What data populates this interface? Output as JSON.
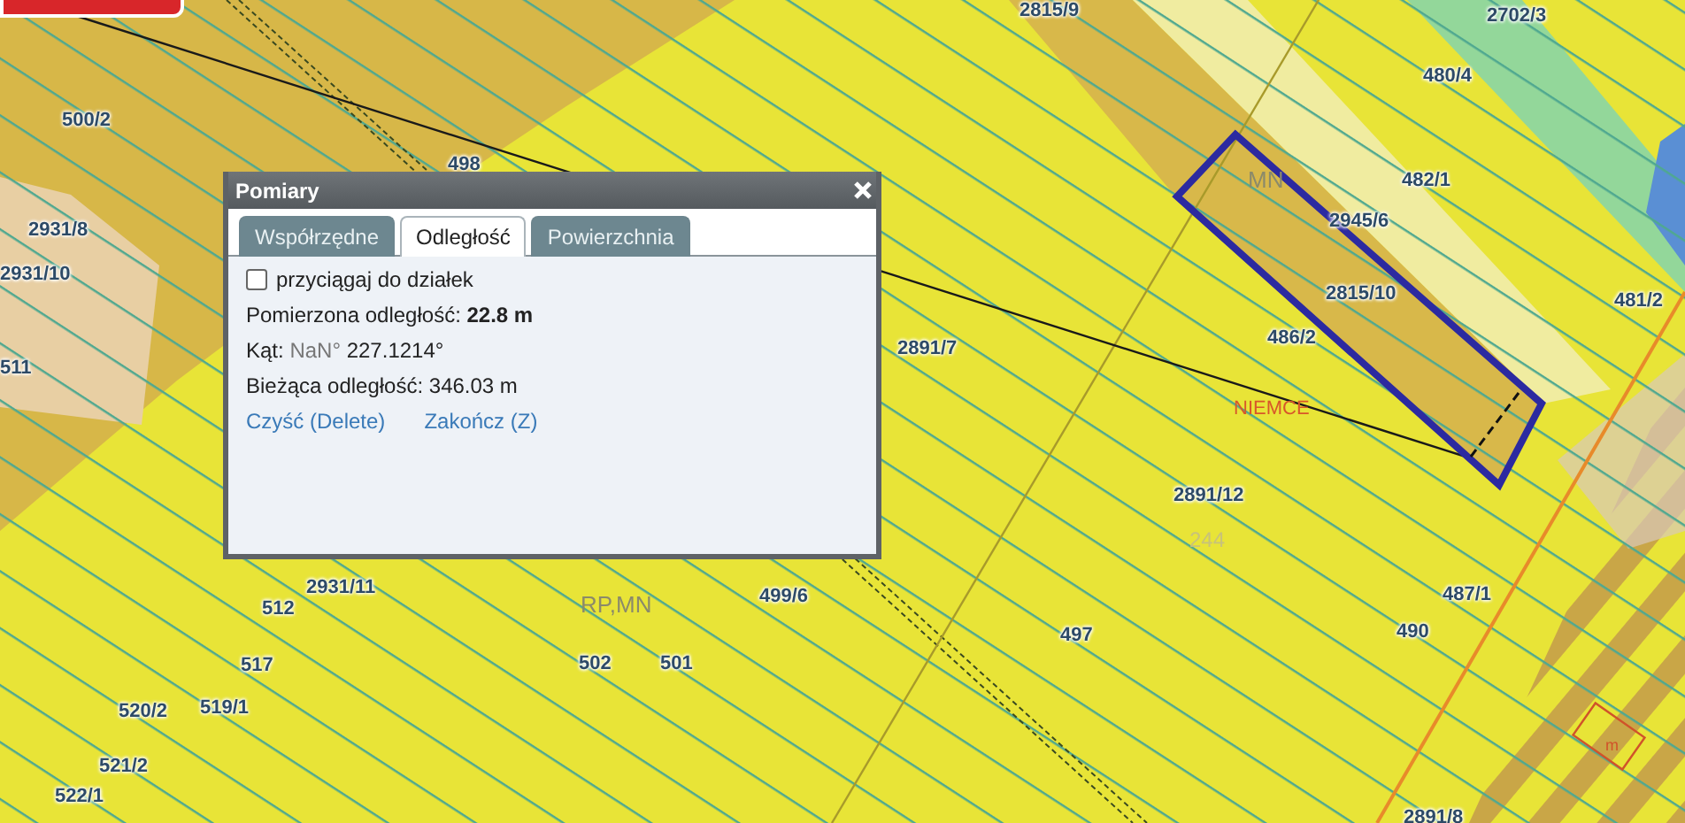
{
  "map": {
    "labels": [
      {
        "text": "500/2",
        "kind": "parcel"
      },
      {
        "text": "498",
        "kind": "parcel"
      },
      {
        "text": "2931/8",
        "kind": "parcel"
      },
      {
        "text": "2931/10",
        "kind": "parcel"
      },
      {
        "text": "511",
        "kind": "parcel"
      },
      {
        "text": "2815/9",
        "kind": "parcel"
      },
      {
        "text": "2702/3",
        "kind": "parcel"
      },
      {
        "text": "480/4",
        "kind": "parcel"
      },
      {
        "text": "MN",
        "kind": "zone"
      },
      {
        "text": "482/1",
        "kind": "parcel"
      },
      {
        "text": "2945/6",
        "kind": "parcel"
      },
      {
        "text": "2815/10",
        "kind": "parcel"
      },
      {
        "text": "481/2",
        "kind": "parcel"
      },
      {
        "text": "486/2",
        "kind": "parcel"
      },
      {
        "text": "2891/7",
        "kind": "parcel"
      },
      {
        "text": "NIEMCE",
        "kind": "place"
      },
      {
        "text": "2891/12",
        "kind": "parcel"
      },
      {
        "text": "244",
        "kind": "number"
      },
      {
        "text": "487/1",
        "kind": "parcel"
      },
      {
        "text": "490",
        "kind": "parcel"
      },
      {
        "text": "497",
        "kind": "parcel"
      },
      {
        "text": "499/6",
        "kind": "parcel"
      },
      {
        "text": "RP,MN",
        "kind": "zone"
      },
      {
        "text": "502",
        "kind": "parcel"
      },
      {
        "text": "501",
        "kind": "parcel"
      },
      {
        "text": "2931/11",
        "kind": "parcel"
      },
      {
        "text": "512",
        "kind": "parcel"
      },
      {
        "text": "517",
        "kind": "parcel"
      },
      {
        "text": "520/2",
        "kind": "parcel"
      },
      {
        "text": "519/1",
        "kind": "parcel"
      },
      {
        "text": "521/2",
        "kind": "parcel"
      },
      {
        "text": "522/1",
        "kind": "parcel"
      },
      {
        "text": "2891/8",
        "kind": "parcel"
      },
      {
        "text": "m",
        "kind": "marker"
      }
    ]
  },
  "dialog": {
    "title": "Pomiary",
    "tabs": [
      {
        "label": "Współrzędne",
        "selected": false
      },
      {
        "label": "Odległość",
        "selected": true
      },
      {
        "label": "Powierzchnia",
        "selected": false
      }
    ],
    "snap": {
      "label": "przyciągaj do działek",
      "checked": false
    },
    "measured": {
      "label": "Pomierzona odległość:",
      "value": "22.8 m"
    },
    "angle": {
      "label": "Kąt:",
      "unknown": "NaN°",
      "value": "227.1214°"
    },
    "current": {
      "label": "Bieżąca odległość:",
      "value": "346.03 m"
    },
    "actions": [
      "Czyść (Delete)",
      "Zakończ (Z)"
    ]
  }
}
